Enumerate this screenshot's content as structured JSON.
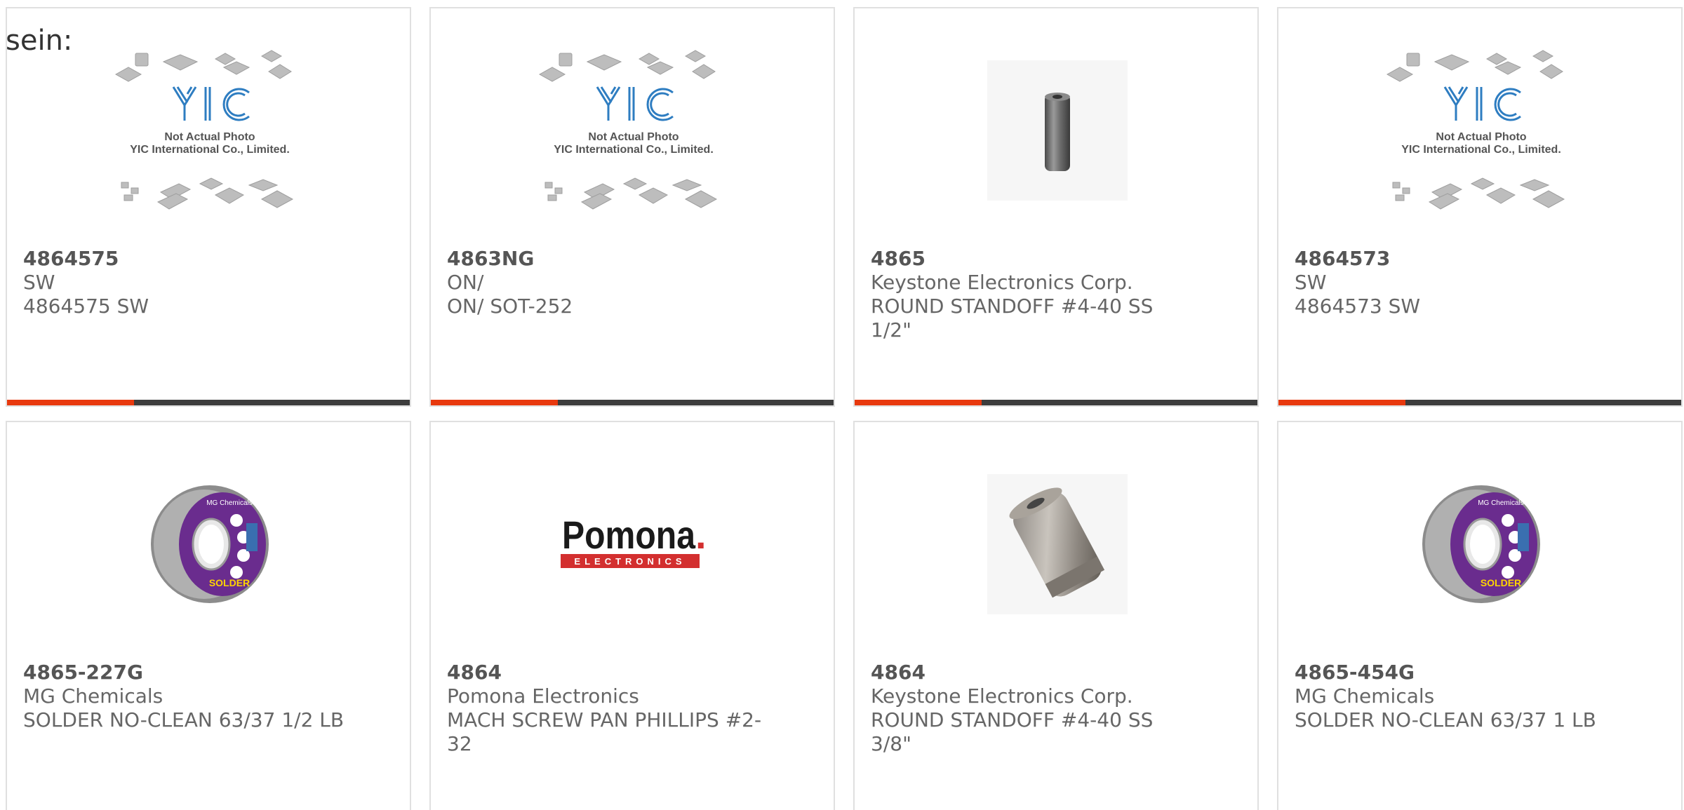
{
  "heading": "sein:",
  "placeholder_photo": {
    "caption_line1": "Not Actual Photo",
    "caption_line2": "YIC International Co., Limited.",
    "logo_text": "YIC"
  },
  "colors": {
    "accent": "#e8390e",
    "bar": "#3d3d3d",
    "border": "#e0e0e0",
    "text": "#666666",
    "solder_label": "#6a2c8e",
    "pomona_red": "#d32f2f"
  },
  "products": [
    {
      "part_number": "4864575",
      "manufacturer": "SW",
      "description": "4864575 SW",
      "image": "yic-placeholder"
    },
    {
      "part_number": "4863NG",
      "manufacturer": "ON/",
      "description": "ON/ SOT-252",
      "image": "yic-placeholder"
    },
    {
      "part_number": "4865",
      "manufacturer": "Keystone Electronics Corp.",
      "description": "ROUND STANDOFF #4-40 SS\n1/2\"",
      "image": "standoff-short"
    },
    {
      "part_number": "4864573",
      "manufacturer": "SW",
      "description": "4864573 SW",
      "image": "yic-placeholder"
    },
    {
      "part_number": "4865-227G",
      "manufacturer": "MG Chemicals",
      "description": "SOLDER NO-CLEAN 63/37 1/2 LB",
      "image": "solder-spool"
    },
    {
      "part_number": "4864",
      "manufacturer": "Pomona Electronics",
      "description": "MACH SCREW PAN PHILLIPS #2-\n32",
      "image": "pomona-logo"
    },
    {
      "part_number": "4864",
      "manufacturer": "Keystone Electronics Corp.",
      "description": "ROUND STANDOFF #4-40 SS\n3/8\"",
      "image": "standoff-angled"
    },
    {
      "part_number": "4865-454G",
      "manufacturer": "MG Chemicals",
      "description": "SOLDER NO-CLEAN 63/37 1 LB",
      "image": "solder-spool"
    }
  ],
  "solder_label_text": "SOLDER",
  "solder_brand_text": "MG Chemicals",
  "pomona_logo": {
    "word": "Pomona",
    "dot": ".",
    "sub": "ELECTRONICS"
  }
}
